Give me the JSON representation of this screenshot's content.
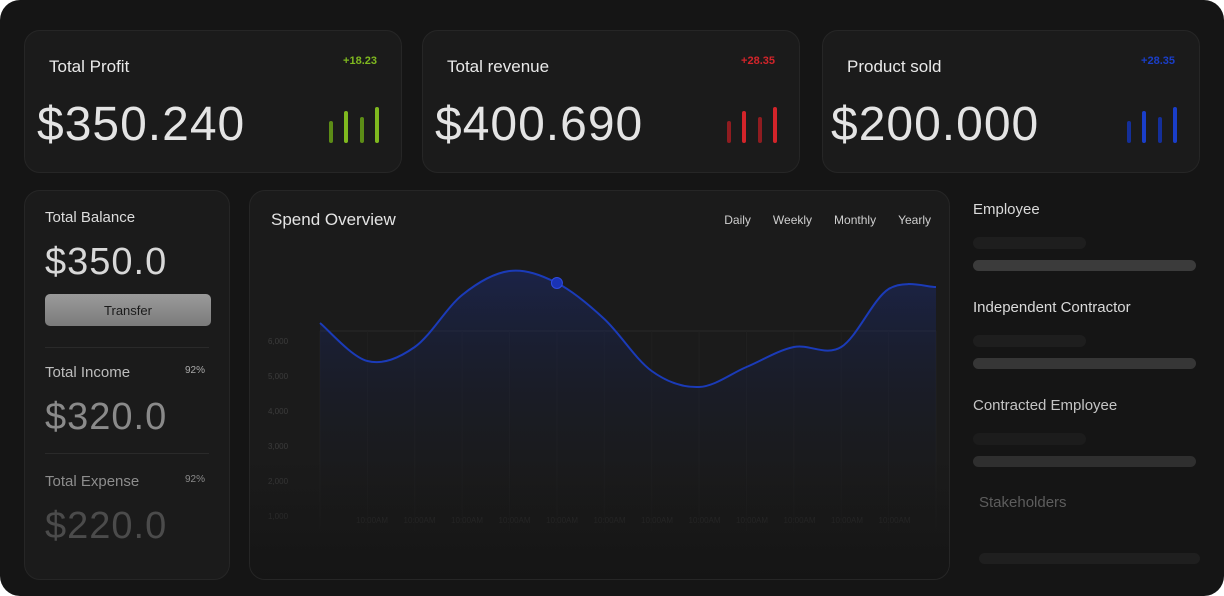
{
  "colors": {
    "green": "#7fb81f",
    "red": "#d3242a",
    "blue": "#1a3ec8",
    "line": "#1b3bb8"
  },
  "stats": [
    {
      "title": "Total Profit",
      "delta": "+18.23",
      "value": "$350.240",
      "color": "green",
      "icon": "bar-chart-icon"
    },
    {
      "title": "Total revenue",
      "delta": "+28.35",
      "value": "$400.690",
      "color": "red",
      "icon": "bar-chart-icon"
    },
    {
      "title": "Product sold",
      "delta": "+28.35",
      "value": "$200.000",
      "color": "blue",
      "icon": "bar-chart-icon"
    }
  ],
  "balance": {
    "title": "Total Balance",
    "value": "$350.0",
    "transfer_label": "Transfer",
    "income_label": "Total Income",
    "income_pct": "92%",
    "income_value": "$320.0",
    "expense_label": "Total Expense",
    "expense_pct": "92%",
    "expense_value": "$220.0"
  },
  "spend": {
    "title": "Spend Overview",
    "tabs": [
      "Daily",
      "Weekly",
      "Monthly",
      "Yearly"
    ]
  },
  "chart_data": {
    "type": "line",
    "title": "Spend Overview",
    "yticks": [
      "6,000",
      "5,000",
      "4,000",
      "3,000",
      "2,000",
      "1,000"
    ],
    "xticks": [
      "10:00AM",
      "10:00AM",
      "10:00AM",
      "10:00AM",
      "10:00AM",
      "10:00AM",
      "10:00AM",
      "10:00AM",
      "10:00AM",
      "10:00AM",
      "10:00AM",
      "10:00AM"
    ],
    "x": [
      0,
      1,
      2,
      3,
      4,
      5,
      6,
      7,
      8,
      9,
      10,
      11,
      12,
      13
    ],
    "values": [
      5900,
      4950,
      5300,
      6600,
      7200,
      6900,
      6000,
      4700,
      4300,
      4800,
      5300,
      5300,
      6750,
      6800
    ],
    "highlight_index": 5,
    "ylim": [
      1000,
      6000
    ],
    "grid": true
  },
  "panel": {
    "items": [
      "Employee",
      "Independent Contractor",
      "Contracted Employee",
      "Stakeholders"
    ]
  }
}
